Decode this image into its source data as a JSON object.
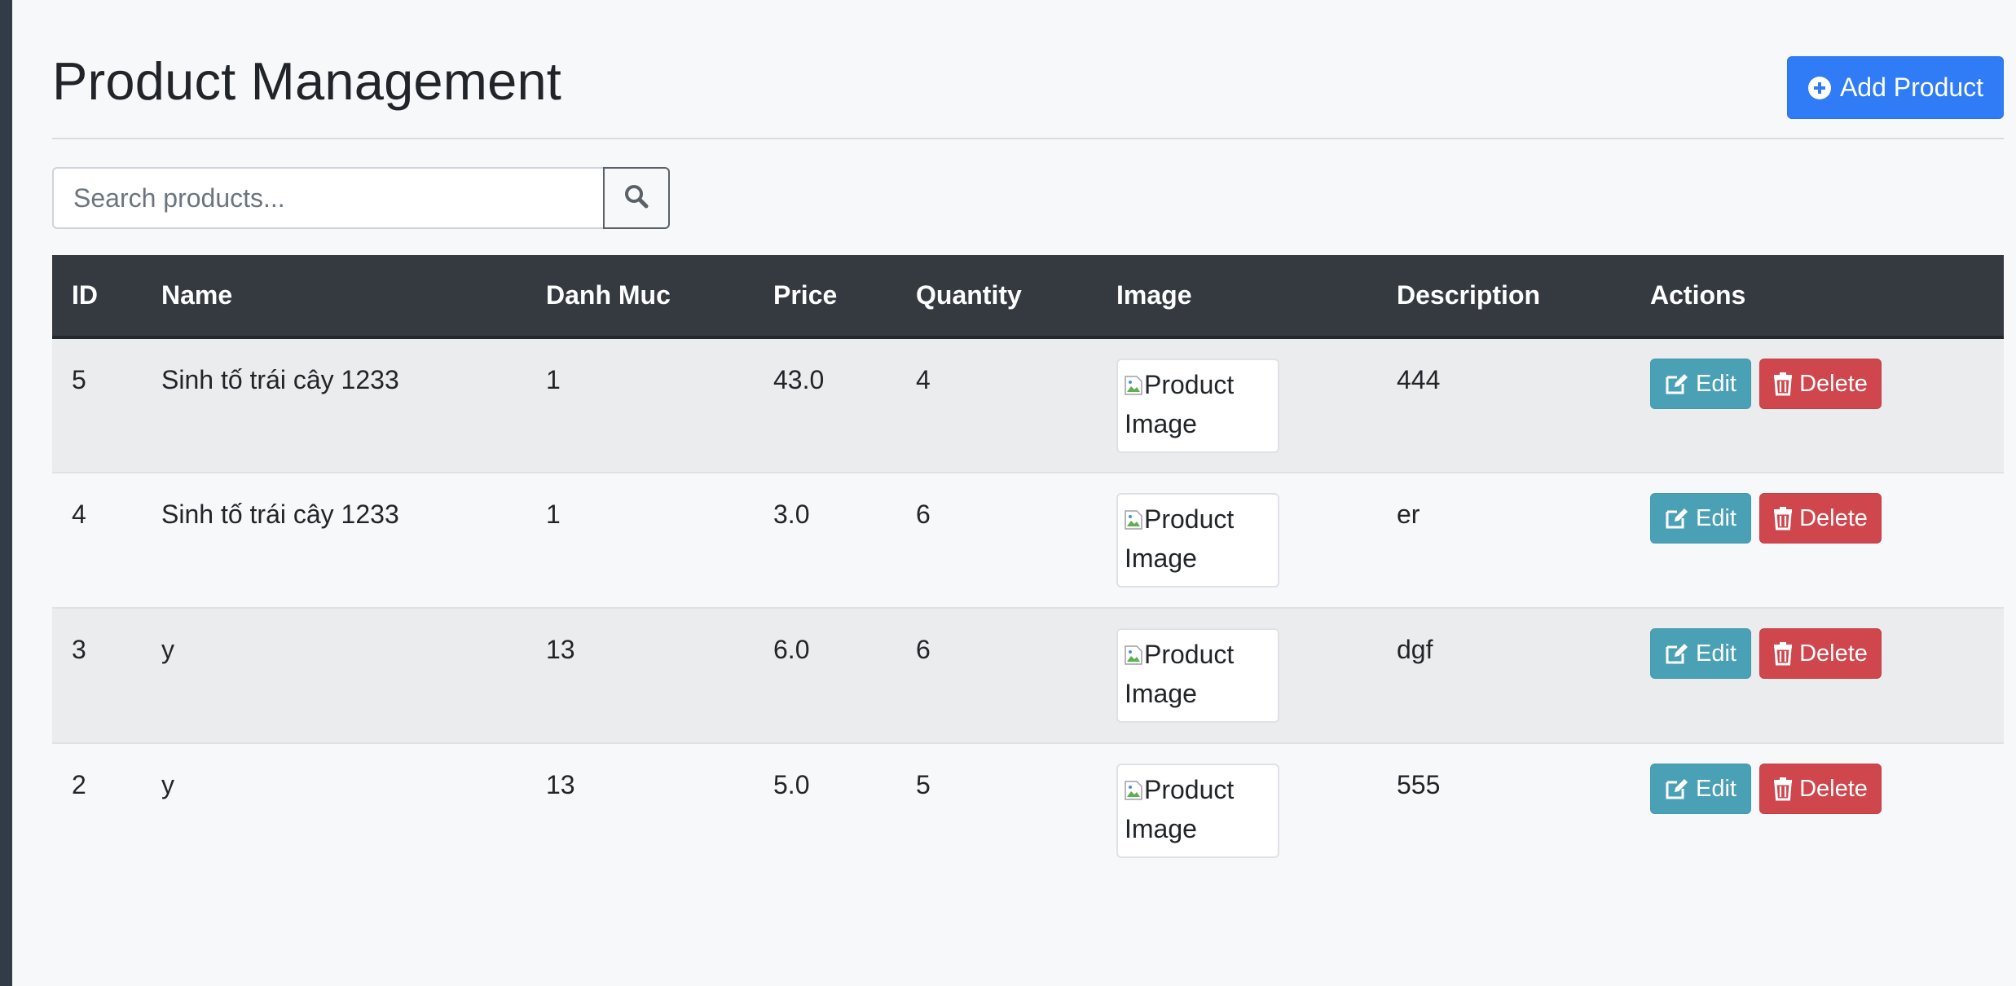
{
  "header": {
    "title": "Product Management",
    "add_button_label": "Add Product"
  },
  "search": {
    "placeholder": "Search products...",
    "value": ""
  },
  "table": {
    "columns": [
      "ID",
      "Name",
      "Danh Muc",
      "Price",
      "Quantity",
      "Image",
      "Description",
      "Actions"
    ],
    "rows": [
      {
        "id": "5",
        "name": "Sinh tố trái cây 1233",
        "category": "1",
        "price": "43.0",
        "quantity": "4",
        "image_alt": "Product Image",
        "description": "444",
        "edit_label": "Edit",
        "delete_label": "Delete"
      },
      {
        "id": "4",
        "name": "Sinh tố trái cây 1233",
        "category": "1",
        "price": "3.0",
        "quantity": "6",
        "image_alt": "Product Image",
        "description": "er",
        "edit_label": "Edit",
        "delete_label": "Delete"
      },
      {
        "id": "3",
        "name": "y",
        "category": "13",
        "price": "6.0",
        "quantity": "6",
        "image_alt": "Product Image",
        "description": "dgf",
        "edit_label": "Edit",
        "delete_label": "Delete"
      },
      {
        "id": "2",
        "name": "y",
        "category": "13",
        "price": "5.0",
        "quantity": "5",
        "image_alt": "Product Image",
        "description": "555",
        "edit_label": "Edit",
        "delete_label": "Delete"
      }
    ]
  },
  "icons": {
    "add": "plus-circle-icon",
    "search": "search-icon",
    "edit": "edit-icon",
    "delete": "trash-icon",
    "broken_image": "broken-image-icon"
  },
  "colors": {
    "primary": "#2f7cf6",
    "info": "#4aa0b5",
    "danger": "#d0464d",
    "table_header": "#343a40",
    "sidebar": "#323c48"
  }
}
